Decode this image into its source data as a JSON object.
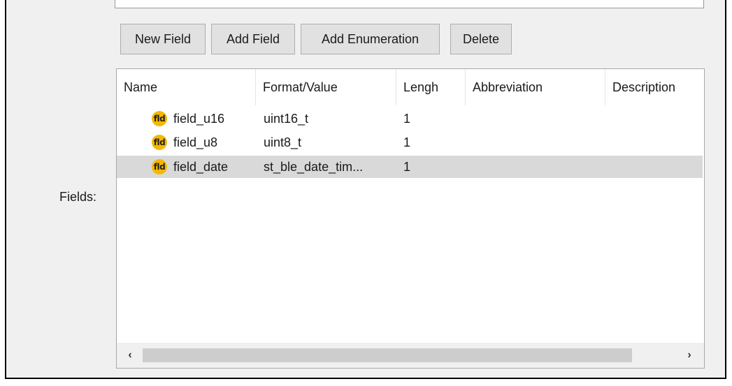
{
  "toolbar": {
    "new_field": "New Field",
    "add_field": "Add Field",
    "add_enumeration": "Add Enumeration",
    "delete": "Delete"
  },
  "fields_label": "Fields:",
  "table": {
    "columns": [
      "Name",
      "Format/Value",
      "Lengh",
      "Abbreviation",
      "Description"
    ],
    "rows": [
      {
        "icon": "fld",
        "name": "field_u16",
        "format": "uint16_t",
        "length": "1",
        "abbreviation": "",
        "description": ""
      },
      {
        "icon": "fld",
        "name": "field_u8",
        "format": "uint8_t",
        "length": "1",
        "abbreviation": "",
        "description": ""
      },
      {
        "icon": "fld",
        "name": "field_date",
        "format": "st_ble_date_tim...",
        "length": "1",
        "abbreviation": "",
        "description": ""
      }
    ],
    "selected_row": 2
  },
  "scrollbar": {
    "left_arrow": "‹",
    "right_arrow": "›"
  },
  "colors": {
    "icon_badge": "#f5b800",
    "selection": "#d9d9d9",
    "panel": "#f0f0f0"
  }
}
